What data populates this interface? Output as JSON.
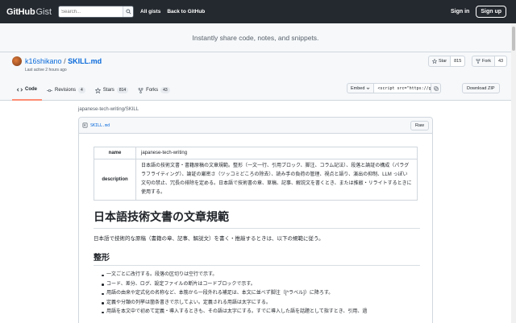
{
  "header": {
    "logo_primary": "GitHub",
    "logo_secondary": "Gist",
    "search_placeholder": "Search...",
    "all_gists": "All gists",
    "back_to_github": "Back to GitHub",
    "sign_in": "Sign in",
    "sign_up": "Sign up"
  },
  "banner": {
    "text": "Instantly share code, notes, and snippets."
  },
  "gist": {
    "owner": "k16shikano",
    "separator": "/",
    "filename": "SKILL.md",
    "last_active": "Last active 2 hours ago",
    "star_label": "Star",
    "star_count": "815",
    "fork_label": "Fork",
    "fork_count": "43"
  },
  "tabs": [
    {
      "label": "Code",
      "count": ""
    },
    {
      "label": "Revisions",
      "count": "4"
    },
    {
      "label": "Stars",
      "count": "814"
    },
    {
      "label": "Forks",
      "count": "43"
    }
  ],
  "embed": {
    "label": "Embed",
    "code": "<script src=\"https://g"
  },
  "download_zip": "Download ZIP",
  "file": {
    "path": "japanese-tech-writing/SKILL",
    "name": "SKILL.md",
    "raw": "Raw"
  },
  "meta_table": {
    "name_key": "name",
    "name_value": "japanese-tech-writing",
    "desc_key": "description",
    "desc_value": "日本語の技術文書・書籍原稿の文章規範。整形（一文一行、引用ブロック、脚注、コラム記法）、段落と論証の構成（パラグラフライティング）、論証の厳密さ（ツッコミどころの除去）、読み手の負荷の管理、視点と語り、演出の抑制、LLM っぽい文句の禁止、冗長の排除を定める。日本語で技術書の章、草稿、記事、解説文を書くとき、または推敲・リライトするときに使用する。"
  },
  "doc": {
    "h1": "日本語技術文書の文章規範",
    "intro": "日本語で技術的な原稿（書籍の章、記事、解説文）を書く・推敲するときは、以下の規範に従う。",
    "h2": "整形",
    "rules": [
      "一文ごとに改行する。段落の区切りは空行で示す。",
      "コード、差分、ログ、設定ファイルの断片はコードブロックで示す。",
      "用語の由来や定式化の名称など、本筋から一段外れる補足は、本文に並べず脚注（[^ラベル]）に降ろす。",
      "定義や分類の列挙は箇条書きで示してよい。定義される用語は太字にする。",
      "用語を本文中で初めて定義・導入するときも、その語は太字にする。すでに導入した語を話題として指すとき、引用、過"
    ]
  }
}
